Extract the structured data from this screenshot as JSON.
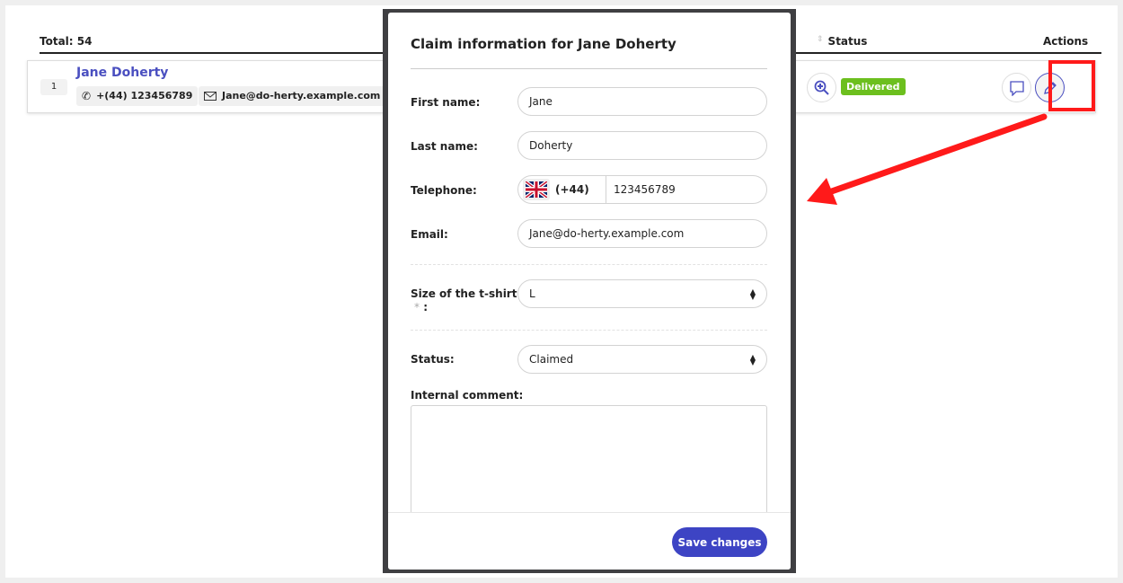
{
  "table": {
    "total": "Total: 54",
    "status_header": "Status",
    "actions_header": "Actions"
  },
  "row": {
    "index": "1",
    "name": "Jane Doherty",
    "phone": "+(44) 123456789",
    "email": "Jane@do-herty.example.com",
    "status": "Delivered"
  },
  "colors": {
    "accent": "#3d44c4",
    "status_delivered": "#6cbf1e",
    "highlight": "#ff1a1a"
  },
  "modal": {
    "title": "Claim information for Jane Doherty",
    "first_name_label": "First name:",
    "first_name": "Jane",
    "last_name_label": "Last name:",
    "last_name": "Doherty",
    "telephone_label": "Telephone:",
    "country_code": "(+44)",
    "telephone": "123456789",
    "email_label": "Email:",
    "email": "Jane@do-herty.example.com",
    "size_label": "Size of the t-shirt",
    "required_mark": "*",
    "size_colon": ":",
    "size": "L",
    "status_label": "Status:",
    "status": "Claimed",
    "comment_label": "Internal comment:",
    "comment": "",
    "save_label": "Save changes"
  }
}
